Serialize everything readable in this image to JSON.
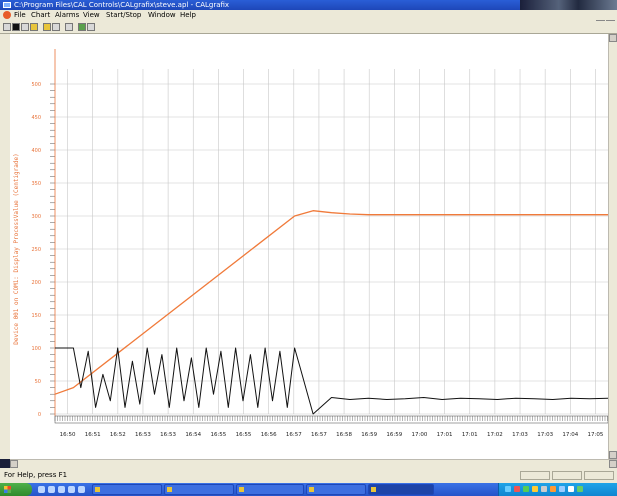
{
  "window": {
    "title": "C:\\Program Files\\CAL Controls\\CALgrafix\\steve.apl - CALgrafix"
  },
  "menu": {
    "items": [
      "File",
      "Chart",
      "Alarms",
      "View",
      "Start/Stop",
      "Window",
      "Help"
    ]
  },
  "toolbar": {
    "buttons": [
      "new-icon",
      "record-icon",
      "settings-icon",
      "alarm-icon",
      "open-icon",
      "save-icon",
      "print-icon",
      "help-icon",
      "context-help-icon"
    ]
  },
  "statusbar": {
    "text": "For Help, press F1"
  },
  "colors": {
    "process_value": "#f07a3a",
    "output_trace": "#111111",
    "axis_label": "#e8733a",
    "grid": "#c8c8c8"
  },
  "chart_data": {
    "type": "line",
    "ylabel": "Device 001 on COM1: Display ProcessValue (Centigrade)",
    "ylim": [
      0,
      500
    ],
    "yticks": [
      0,
      50,
      100,
      150,
      200,
      250,
      300,
      350,
      400,
      450,
      500
    ],
    "xlim": [
      0,
      30
    ],
    "grid": true,
    "x_tick_labels": [
      "16:50",
      "16:51",
      "16:52",
      "16:53",
      "16:53",
      "16:54",
      "16:55",
      "16:55",
      "16:56",
      "16:57",
      "16:57",
      "16:58",
      "16:59",
      "16:59",
      "17:00",
      "17:01",
      "17:01",
      "17:02",
      "17:03",
      "17:03",
      "17:04",
      "17:05"
    ],
    "series": [
      {
        "x": [
          0,
          1,
          13,
          14,
          15,
          16,
          17,
          30
        ],
        "y": [
          30,
          40,
          300,
          308,
          305,
          303,
          302,
          302
        ]
      },
      {
        "x": [
          0,
          0.5,
          1,
          1.4,
          1.8,
          2.2,
          2.6,
          3,
          3.4,
          3.8,
          4.2,
          4.6,
          5,
          5.4,
          5.8,
          6.2,
          6.6,
          7,
          7.4,
          7.8,
          8.2,
          8.6,
          9,
          9.4,
          9.8,
          10.2,
          10.6,
          11,
          11.4,
          11.8,
          12.2,
          12.6,
          13,
          13.3,
          14,
          15,
          16,
          17,
          18,
          19,
          20,
          21,
          22,
          23,
          24,
          25,
          26,
          27,
          28,
          29,
          30
        ],
        "y": [
          100,
          100,
          100,
          40,
          95,
          10,
          60,
          20,
          100,
          10,
          80,
          15,
          100,
          30,
          90,
          10,
          100,
          20,
          85,
          10,
          100,
          30,
          95,
          10,
          100,
          20,
          90,
          10,
          100,
          20,
          95,
          10,
          100,
          70,
          0,
          25,
          22,
          24,
          22,
          23,
          25,
          22,
          24,
          23,
          22,
          24,
          23,
          22,
          24,
          23,
          24
        ]
      }
    ]
  }
}
